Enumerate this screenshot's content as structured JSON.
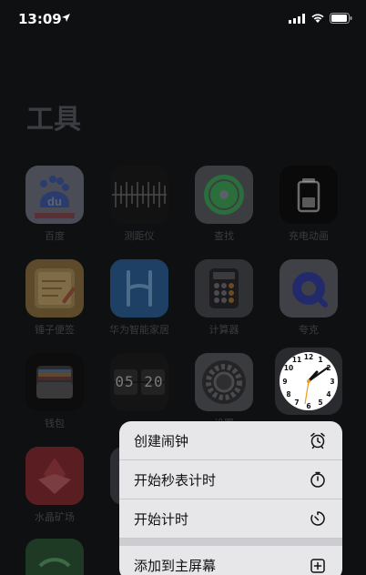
{
  "status": {
    "time": "13:09"
  },
  "page": {
    "title": "工具"
  },
  "apps": [
    {
      "label": "百度"
    },
    {
      "label": "测距仪"
    },
    {
      "label": "查找"
    },
    {
      "label": "充电动画"
    },
    {
      "label": "锤子便签"
    },
    {
      "label": "华为智能家居"
    },
    {
      "label": "计算器"
    },
    {
      "label": "夸克"
    },
    {
      "label": "钱包"
    },
    {
      "label": ""
    },
    {
      "label": "设置"
    },
    {
      "label": "时钟"
    },
    {
      "label": "水晶矿场"
    }
  ],
  "app_icon_text": {
    "baidu": "du",
    "widget_time": "05 20"
  },
  "context_menu": {
    "items": [
      {
        "label": "创建闹钟",
        "icon": "alarm-clock-icon"
      },
      {
        "label": "开始秒表计时",
        "icon": "stopwatch-icon"
      },
      {
        "label": "开始计时",
        "icon": "timer-icon"
      },
      {
        "label": "添加到主屏幕",
        "icon": "add-square-icon"
      }
    ]
  }
}
